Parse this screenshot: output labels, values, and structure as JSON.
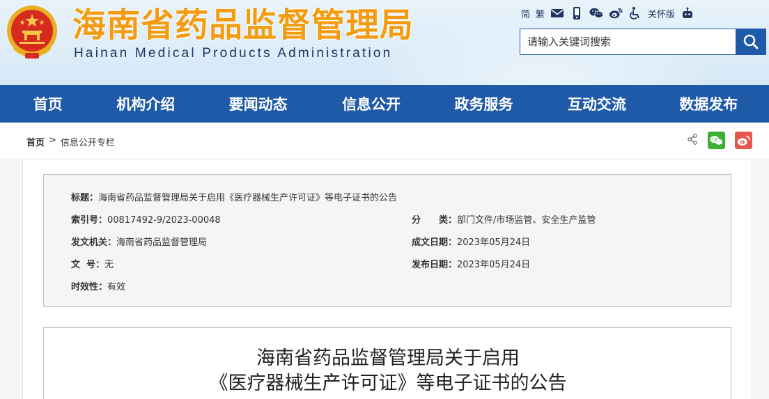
{
  "header": {
    "title": "海南省药品监督管理局",
    "subtitle": "Hainan Medical Products Administration",
    "tools": {
      "simplified": "简",
      "traditional": "繁",
      "care_mode": "关怀版"
    },
    "search": {
      "placeholder": "请输入关键词搜索"
    }
  },
  "nav": {
    "items": [
      "首页",
      "机构介绍",
      "要闻动态",
      "信息公开",
      "政务服务",
      "互动交流",
      "数据发布"
    ]
  },
  "breadcrumb": {
    "home": "首页",
    "separator": ">",
    "current": "信息公开专栏"
  },
  "meta": {
    "title_label": "标题：",
    "title_value": "海南省药品监督管理局关于启用《医疗器械生产许可证》等电子证书的公告",
    "index_label": "索引号：",
    "index_value": "00817492-9/2023-00048",
    "category_label": "分　　类：",
    "category_value": "部门文件/市场监管、安全生产监管",
    "issuer_label": "发文机关：",
    "issuer_value": "海南省药品监督管理局",
    "created_label": "成文日期：",
    "created_value": "2023年05月24日",
    "docno_label": "文  号：",
    "docno_value": "无",
    "published_label": "发布日期：",
    "published_value": "2023年05月24日",
    "validity_label": "时效性：",
    "validity_value": "有效"
  },
  "article": {
    "title_line1": "海南省药品监督管理局关于启用",
    "title_line2": "《医疗器械生产许可证》等电子证书的公告"
  },
  "colors": {
    "brand_blue": "#1e5aa8",
    "title_orange": "#f39c12",
    "wechat_green": "#3cb034",
    "weibo_red": "#e6574f"
  },
  "icons": [
    "mail-icon",
    "mobile-icon",
    "wechat-icon",
    "weibo-icon",
    "accessibility-icon",
    "robot-icon",
    "search-icon",
    "share-icon"
  ]
}
